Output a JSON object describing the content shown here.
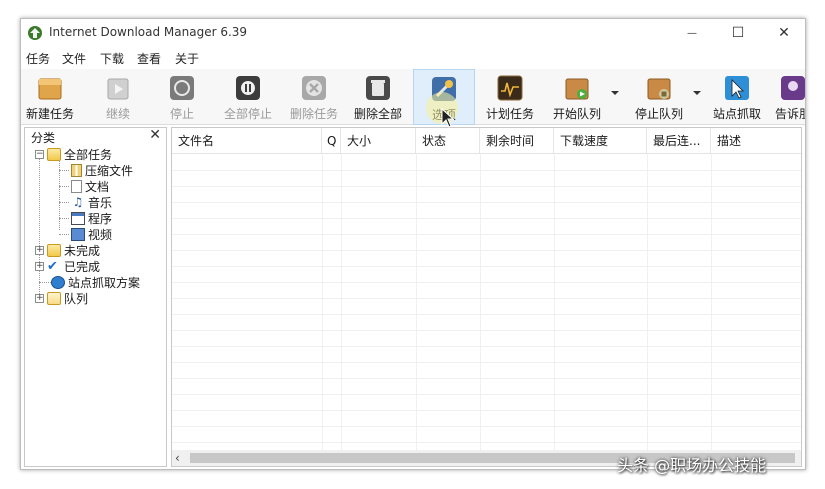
{
  "window": {
    "title": "Internet Download Manager 6.39",
    "minimize_glyph": "—",
    "maximize_glyph": "☐",
    "close_glyph": "✕"
  },
  "menu": [
    "任务",
    "文件",
    "下载",
    "查看",
    "关于"
  ],
  "toolbar": [
    {
      "label": "新建任务",
      "icon": "new-task-icon",
      "enabled": true
    },
    {
      "label": "继续",
      "icon": "resume-icon",
      "enabled": false
    },
    {
      "label": "停止",
      "icon": "stop-icon",
      "enabled": false
    },
    {
      "label": "全部停止",
      "icon": "stop-all-icon",
      "enabled": false
    },
    {
      "label": "删除任务",
      "icon": "delete-task-icon",
      "enabled": false
    },
    {
      "label": "删除全部",
      "icon": "delete-all-icon",
      "enabled": true
    },
    {
      "label": "选项",
      "icon": "options-icon",
      "enabled": true
    },
    {
      "label": "计划任务",
      "icon": "scheduler-icon",
      "enabled": true
    },
    {
      "label": "开始队列",
      "icon": "start-queue-icon",
      "enabled": true
    },
    {
      "label": "停止队列",
      "icon": "stop-queue-icon",
      "enabled": true
    },
    {
      "label": "站点抓取",
      "icon": "site-grabber-icon",
      "enabled": true
    },
    {
      "label": "告诉朋",
      "icon": "tell-friend-icon",
      "enabled": true
    }
  ],
  "categories": {
    "title": "分类",
    "close_glyph": "✕",
    "items": [
      {
        "label": "全部任务",
        "icon": "folder-open-icon",
        "expander": "−"
      },
      {
        "label": "压缩文件",
        "icon": "zip-file-icon"
      },
      {
        "label": "文档",
        "icon": "document-icon"
      },
      {
        "label": "音乐",
        "icon": "music-icon"
      },
      {
        "label": "程序",
        "icon": "program-icon"
      },
      {
        "label": "视频",
        "icon": "video-icon"
      },
      {
        "label": "未完成",
        "icon": "unfinished-icon",
        "expander": "+"
      },
      {
        "label": "已完成",
        "icon": "finished-icon",
        "expander": "+"
      },
      {
        "label": "站点抓取方案",
        "icon": "grabber-project-icon"
      },
      {
        "label": "队列",
        "icon": "queue-folder-icon",
        "expander": "+"
      }
    ]
  },
  "columns": [
    "文件名",
    "Q",
    "大小",
    "状态",
    "剩余时间",
    "下载速度",
    "最后连...",
    "描述"
  ],
  "scroll_left_glyph": "‹",
  "watermark": "头条 @职场办公技能",
  "colors": {
    "accent_hover": "#dfeefa",
    "disabled_text": "#9a9a9a"
  }
}
